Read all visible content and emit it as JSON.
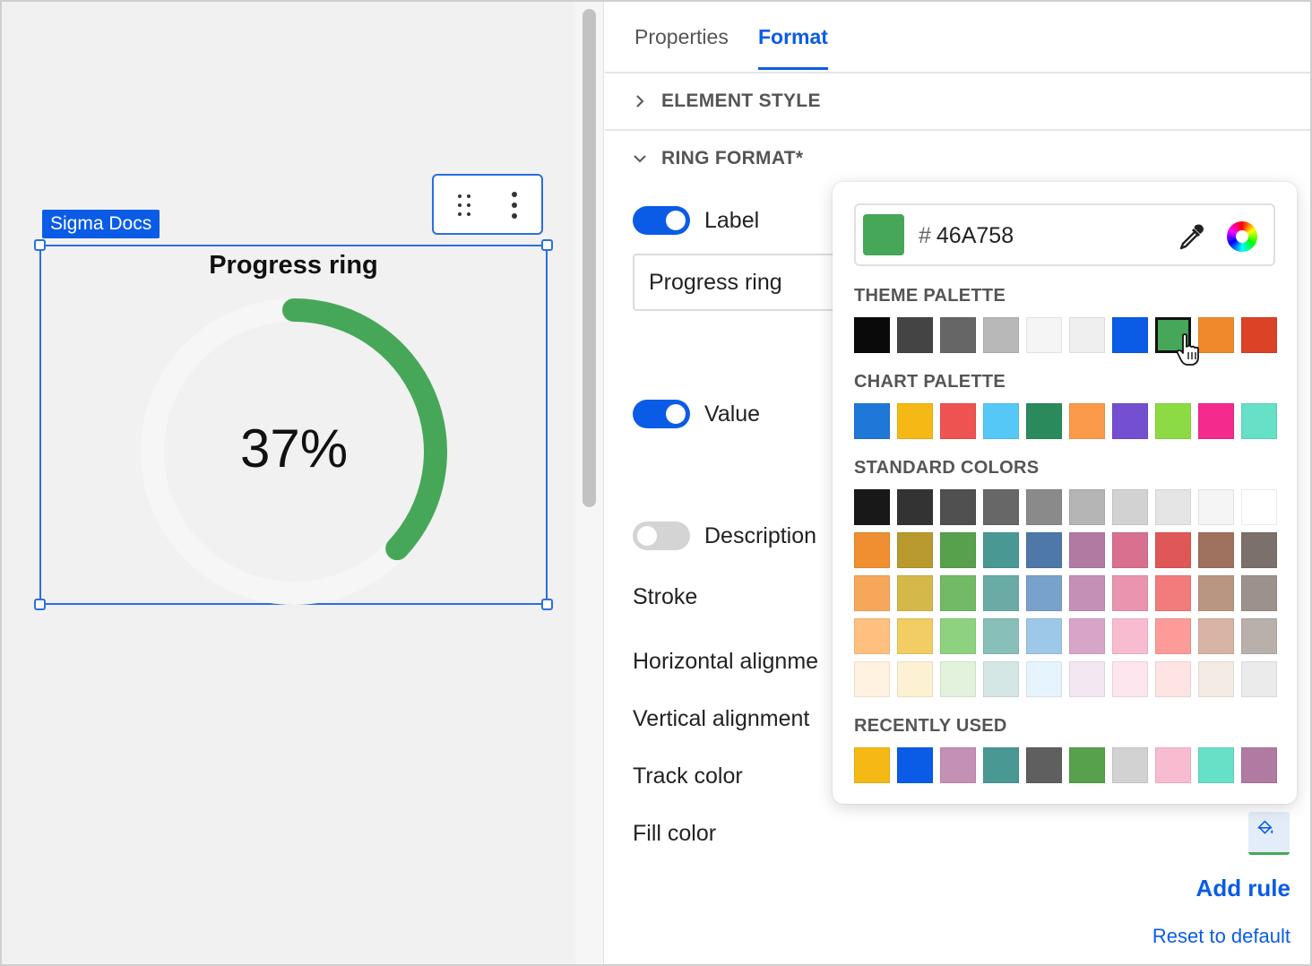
{
  "canvas": {
    "selection_tag": "Sigma Docs",
    "widget": {
      "title": "Progress ring",
      "value_label": "37%",
      "progress": 0.37,
      "fill_color": "#46A758",
      "track_color": "#f6f6f6"
    }
  },
  "panel": {
    "tabs": [
      {
        "label": "Properties",
        "active": false
      },
      {
        "label": "Format",
        "active": true
      }
    ],
    "sections": {
      "element_style": "ELEMENT STYLE",
      "ring_format": "RING FORMAT*"
    },
    "label_toggle": {
      "label": "Label",
      "on": true,
      "value": "Progress ring"
    },
    "value_toggle": {
      "label": "Value",
      "on": true
    },
    "description_toggle": {
      "label": "Description",
      "on": false
    },
    "rows": {
      "stroke": "Stroke",
      "horizontal_alignment": "Horizontal alignme",
      "vertical_alignment": "Vertical alignment",
      "track_color": "Track color",
      "fill_color": "Fill color"
    },
    "add_rule": "Add rule",
    "reset": "Reset to default"
  },
  "color_picker": {
    "hex_prefix": "#",
    "hex_value": "46A758",
    "selected_color": "#46A758",
    "theme_palette_title": "THEME PALETTE",
    "theme_palette": [
      "#0a0a0a",
      "#444444",
      "#666666",
      "#b8b8b8",
      "#f5f5f5",
      "#efefef",
      "#0a5ce6",
      "#46A758",
      "#ef8a2c",
      "#dc4225"
    ],
    "chart_palette_title": "CHART PALETTE",
    "chart_palette": [
      "#1f78d8",
      "#f5b915",
      "#ee5351",
      "#55c8f8",
      "#2a8a5c",
      "#fb9a4a",
      "#744fd0",
      "#8ddb44",
      "#f42a8c",
      "#66e0c6"
    ],
    "standard_colors_title": "STANDARD COLORS",
    "standard_colors": [
      [
        "#181818",
        "#333333",
        "#505050",
        "#676767",
        "#8a8a8a",
        "#b5b5b5",
        "#d2d2d2",
        "#e5e5e5",
        "#f5f5f5",
        "#ffffff"
      ],
      [
        "#ef8f31",
        "#b89a2e",
        "#57a14c",
        "#4a9894",
        "#4e78a8",
        "#b07aa2",
        "#d8708f",
        "#e05758",
        "#9e725f",
        "#7b706b"
      ],
      [
        "#f7a75a",
        "#d4b84a",
        "#72ba66",
        "#6aaba6",
        "#78a2cc",
        "#c490b6",
        "#ea95af",
        "#f27c7b",
        "#b99682",
        "#9c918c"
      ],
      [
        "#ffbf7f",
        "#f1cd64",
        "#8ed17f",
        "#88bfb9",
        "#9ec8e8",
        "#d7a5c8",
        "#f8bcd0",
        "#fd9b98",
        "#d7b4a4",
        "#b9afab"
      ],
      [
        "#fff2e0",
        "#fdf1d3",
        "#e2f2dc",
        "#d5e7e5",
        "#e6f5fd",
        "#f3e7f1",
        "#fde6ed",
        "#fee4e3",
        "#f4ebe5",
        "#ebebeb"
      ]
    ],
    "recently_used_title": "RECENTLY USED",
    "recently_used": [
      "#f5b915",
      "#0a5ce6",
      "#c490b6",
      "#4a9894",
      "#5f5f5f",
      "#57a14c",
      "#d2d2d2",
      "#f8bcd0",
      "#66e0c6",
      "#b07aa2"
    ]
  }
}
